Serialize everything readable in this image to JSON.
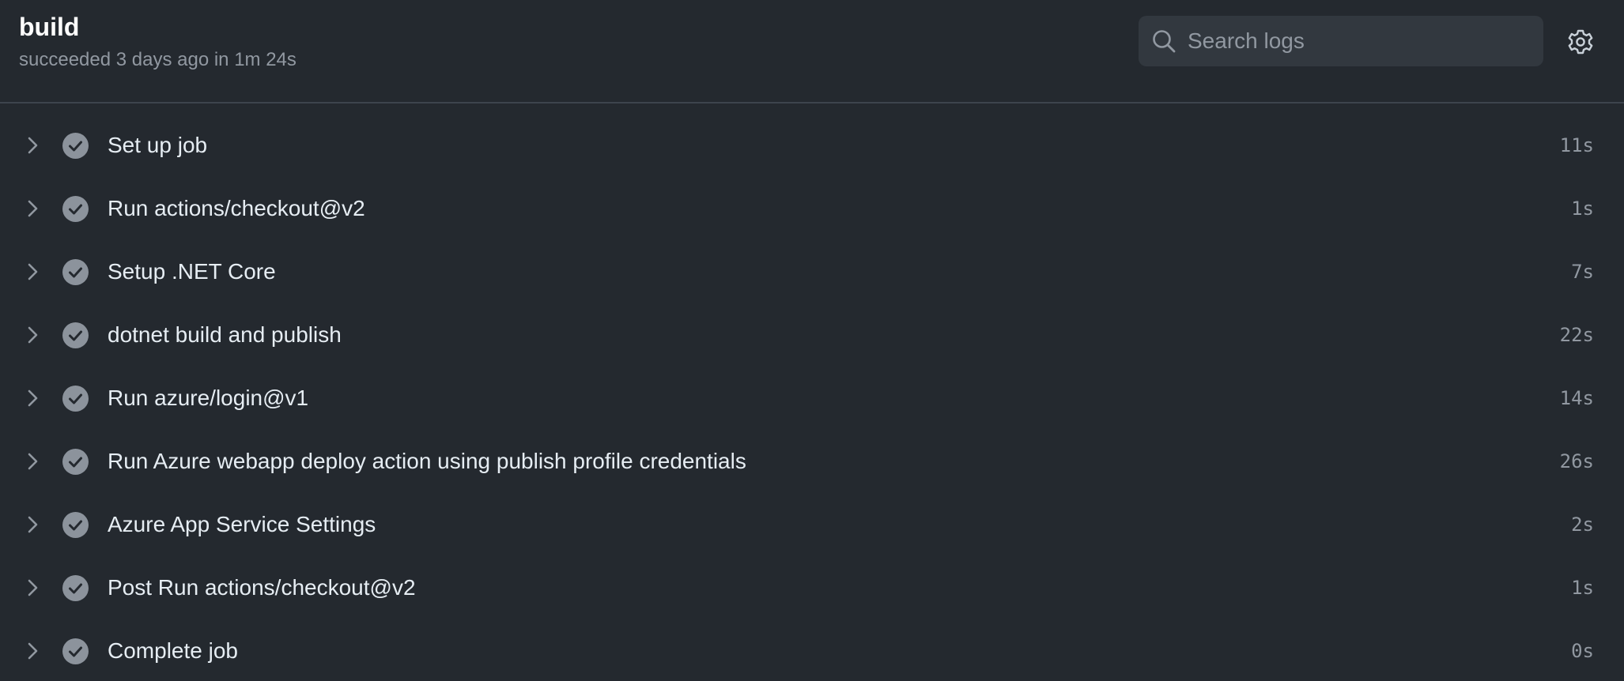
{
  "header": {
    "title": "build",
    "status": "succeeded 3 days ago in 1m 24s"
  },
  "search": {
    "placeholder": "Search logs",
    "value": ""
  },
  "icons": {
    "search": "search-icon",
    "settings": "gear-icon",
    "expand": "chevron-right-icon",
    "status": "check-circle-icon"
  },
  "colors": {
    "background": "#24292f",
    "check_fill": "#8c939c",
    "text": "#e6edf3",
    "muted": "#9198a1"
  },
  "steps": [
    {
      "name": "Set up job",
      "duration": "11s"
    },
    {
      "name": "Run actions/checkout@v2",
      "duration": "1s"
    },
    {
      "name": "Setup .NET Core",
      "duration": "7s"
    },
    {
      "name": "dotnet build and publish",
      "duration": "22s"
    },
    {
      "name": "Run azure/login@v1",
      "duration": "14s"
    },
    {
      "name": "Run Azure webapp deploy action using publish profile credentials",
      "duration": "26s"
    },
    {
      "name": "Azure App Service Settings",
      "duration": "2s"
    },
    {
      "name": "Post Run actions/checkout@v2",
      "duration": "1s"
    },
    {
      "name": "Complete job",
      "duration": "0s"
    }
  ]
}
